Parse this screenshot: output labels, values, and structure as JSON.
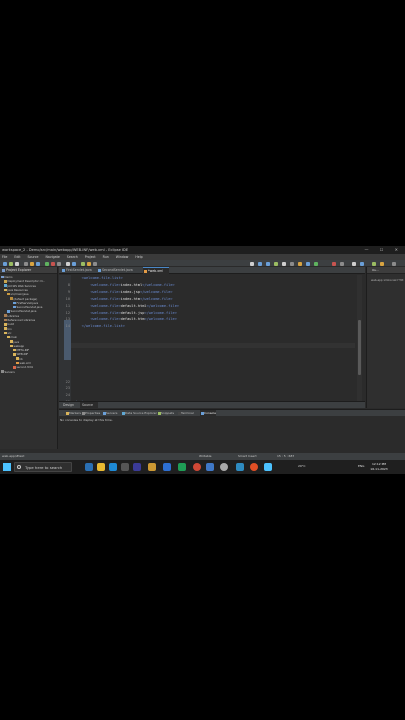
{
  "window": {
    "title": "workspace_2 - Demo/src/main/webapp/WEB-INF/web.xml - Eclipse IDE",
    "controls": "— ☐ ✕"
  },
  "menu": [
    "File",
    "Edit",
    "Source",
    "Navigate",
    "Search",
    "Project",
    "Run",
    "Window",
    "Help"
  ],
  "project_explorer": {
    "title": "Project Explorer",
    "tree": [
      {
        "label": "Demo",
        "icon": "project-icon"
      },
      {
        "label": "Deployment Descriptor: D...",
        "icon": "descriptor-icon"
      },
      {
        "label": "JAX-WS Web Services",
        "icon": "webservice-icon"
      },
      {
        "label": "Java Resources",
        "icon": "folder-icon"
      },
      {
        "label": "src/main/java",
        "icon": "package-folder-icon"
      },
      {
        "label": "(default package)",
        "icon": "package-icon"
      },
      {
        "label": "FirstServlet.java",
        "icon": "java-file-icon"
      },
      {
        "label": "SecondServlet.java",
        "icon": "java-file-icon"
      },
      {
        "label": "SecondServlet.java",
        "icon": "java-file-icon"
      },
      {
        "label": "Libraries",
        "icon": "library-icon"
      },
      {
        "label": "Referenced Libraries",
        "icon": "library-icon"
      },
      {
        "label": "build",
        "icon": "folder-icon"
      },
      {
        "label": "bin",
        "icon": "folder-icon"
      },
      {
        "label": "src",
        "icon": "folder-icon"
      },
      {
        "label": "main",
        "icon": "folder-icon"
      },
      {
        "label": "java",
        "icon": "folder-icon"
      },
      {
        "label": "webapp",
        "icon": "folder-icon"
      },
      {
        "label": "META-INF",
        "icon": "folder-icon"
      },
      {
        "label": "WEB-INF",
        "icon": "folder-icon"
      },
      {
        "label": "lib",
        "icon": "folder-icon"
      },
      {
        "label": "web.xml",
        "icon": "xml-file-icon"
      },
      {
        "label": "second.html",
        "icon": "html-file-icon"
      },
      {
        "label": "Servers",
        "icon": "server-icon"
      }
    ]
  },
  "editor": {
    "tabs": [
      {
        "label": "FirstServlet.java",
        "active": false
      },
      {
        "label": "SecondServlet.java",
        "active": false
      },
      {
        "label": "*web.xml",
        "active": true
      }
    ],
    "lines": [
      {
        "num": "",
        "indent": "    ",
        "tag1": "<welcome-file-list>",
        "text": "",
        "tag2": ""
      },
      {
        "num": "8",
        "indent": "        ",
        "tag1": "<welcome-file>",
        "text": "index.html",
        "tag2": "</welcome-file>"
      },
      {
        "num": "9",
        "indent": "        ",
        "tag1": "<welcome-file>",
        "text": "index.jsp",
        "tag2": "</welcome-file>"
      },
      {
        "num": "10",
        "indent": "        ",
        "tag1": "<welcome-file>",
        "text": "index.htm",
        "tag2": "</welcome-file>"
      },
      {
        "num": "11",
        "indent": "        ",
        "tag1": "<welcome-file>",
        "text": "default.html",
        "tag2": "</welcome-file>"
      },
      {
        "num": "12",
        "indent": "        ",
        "tag1": "<welcome-file>",
        "text": "default.jsp",
        "tag2": "</welcome-file>"
      },
      {
        "num": "13",
        "indent": "        ",
        "tag1": "<welcome-file>",
        "text": "default.htm",
        "tag2": "</welcome-file>"
      },
      {
        "num": "14",
        "indent": "    ",
        "tag1": "</welcome-file-list>",
        "text": "",
        "tag2": ""
      },
      {
        "num": "",
        "indent": "",
        "tag1": "",
        "text": "",
        "tag2": ""
      },
      {
        "num": "",
        "indent": "",
        "tag1": "",
        "text": "",
        "tag2": ""
      },
      {
        "num": "",
        "indent": "",
        "tag1": "",
        "text": "",
        "tag2": ""
      },
      {
        "num": "",
        "indent": "",
        "tag1": "",
        "text": "",
        "tag2": ""
      },
      {
        "num": "",
        "indent": "",
        "tag1": "",
        "text": "",
        "tag2": ""
      },
      {
        "num": "",
        "indent": "",
        "tag1": "",
        "text": "",
        "tag2": ""
      },
      {
        "num": "",
        "indent": "",
        "tag1": "",
        "text": "",
        "tag2": ""
      },
      {
        "num": "22",
        "indent": "",
        "tag1": "",
        "text": "",
        "tag2": ""
      },
      {
        "num": "23",
        "indent": "",
        "tag1": "",
        "text": "",
        "tag2": ""
      },
      {
        "num": "24",
        "indent": "",
        "tag1": "",
        "text": "",
        "tag2": ""
      },
      {
        "num": "25",
        "indent": "",
        "tag1": "</web-app>",
        "text": "",
        "tag2": ""
      }
    ],
    "bottom_tabs": [
      "Design",
      "Source"
    ]
  },
  "outline": {
    "title": "Ou...",
    "item": "web-app xmlns:xsi=\"htt"
  },
  "bottom_panel": {
    "tabs": [
      {
        "label": "Markers",
        "icon": "markers-icon",
        "active": false
      },
      {
        "label": "Properties",
        "icon": "properties-icon",
        "active": false
      },
      {
        "label": "Servers",
        "icon": "servers-icon",
        "active": false
      },
      {
        "label": "Data Source Explorer",
        "icon": "datasource-icon",
        "active": false
      },
      {
        "label": "Snippets",
        "icon": "snippets-icon",
        "active": false
      },
      {
        "label": "Terminal",
        "icon": "terminal-icon",
        "active": false
      },
      {
        "label": "Console",
        "icon": "console-icon",
        "active": true
      }
    ],
    "message": "No consoles to display at this time."
  },
  "status": {
    "path": "web-app/#text",
    "writable": "Writable",
    "insert_mode": "Smart Insert",
    "position": "15 : 5 : 687"
  },
  "taskbar": {
    "search_placeholder": "Type here to search",
    "weather": "29°C",
    "lang": "ENG",
    "time": "12:12 PM",
    "date": "16-11-2023",
    "colors": {
      "accent": "#4cc2ff"
    }
  }
}
